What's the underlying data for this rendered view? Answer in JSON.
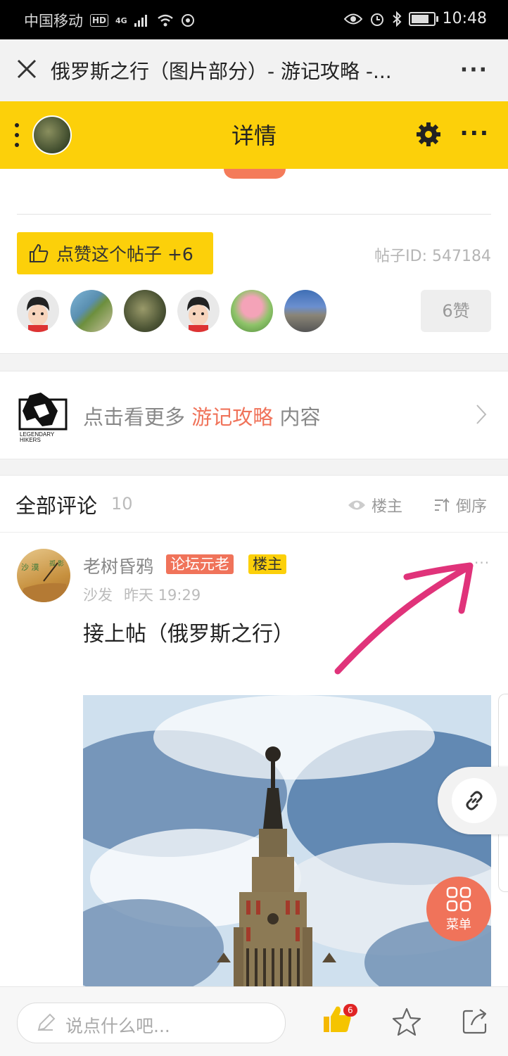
{
  "status_bar": {
    "carrier": "中国移动",
    "hd": "HD",
    "network": "4G",
    "time": "10:48"
  },
  "title_bar": {
    "title": "俄罗斯之行（图片部分）- 游记攻略 -...",
    "more": "···"
  },
  "header": {
    "heading": "详情",
    "more": "···"
  },
  "post": {
    "like_button": "点赞这个帖子 +6",
    "post_id": "帖子ID: 547184",
    "like_count": "6赞"
  },
  "more_link": {
    "prefix": "点击看更多 ",
    "highlight": "游记攻略",
    "suffix": " 内容",
    "logo_text": "LEGENDARY HIKERS"
  },
  "comments": {
    "title": "全部评论",
    "count": "10",
    "host_only": "楼主",
    "order": "倒序"
  },
  "comment": {
    "author": "老树昏鸦",
    "badge1": "论坛元老",
    "badge2": "楼主",
    "floor": "沙发",
    "time": "昨天 19:29",
    "text": "接上帖（俄罗斯之行）",
    "more": "···"
  },
  "floating": {
    "menu_label": "菜单"
  },
  "bottom_bar": {
    "input_placeholder": "说点什么吧...",
    "like_badge": "6"
  },
  "colors": {
    "accent_yellow": "#fcd00a",
    "accent_orange": "#f0735a",
    "arrow_pink": "#e0337a"
  }
}
